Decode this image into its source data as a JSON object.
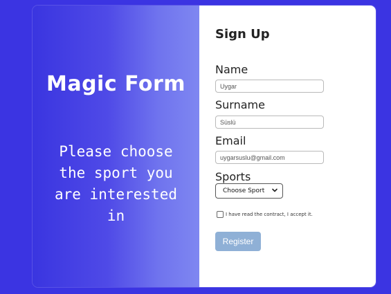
{
  "left_panel": {
    "brand_title": "Magic Form",
    "message": "Please choose the sport you are interested in"
  },
  "form": {
    "title": "Sign Up",
    "fields": {
      "name": {
        "label": "Name",
        "value": "Uygar"
      },
      "surname": {
        "label": "Surname",
        "value": "Süslü"
      },
      "email": {
        "label": "Email",
        "value": "uygarsuslu@gmail.com"
      },
      "sports": {
        "label": "Sports",
        "selected": "Choose Sport"
      }
    },
    "agreement_text": "I have read the contract, I accept it.",
    "register_label": "Register"
  },
  "colors": {
    "page_background": "#3b34e2",
    "gradient_start": "#3a35e0",
    "gradient_end": "#7f87f1",
    "button_background": "#8fb0d6"
  }
}
